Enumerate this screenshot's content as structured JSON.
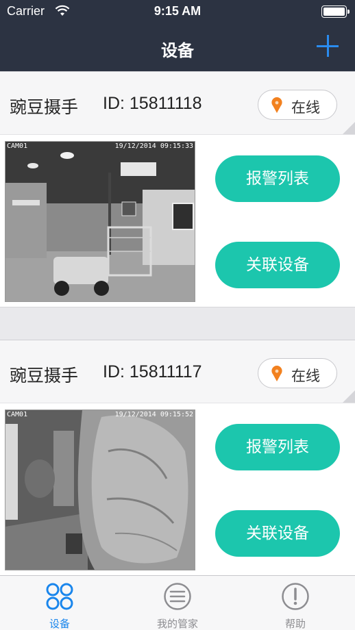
{
  "status_bar": {
    "carrier": "Carrier",
    "time": "9:15 AM"
  },
  "nav": {
    "title": "设备",
    "add_icon": "plus-icon"
  },
  "devices": [
    {
      "name": "豌豆摄手",
      "id_text": "ID: 15811118",
      "status": "在线",
      "cam_label": "CAM01",
      "cam_timestamp": "19/12/2014 09:15:33",
      "alarm_button": "报警列表",
      "link_button": "关联设备"
    },
    {
      "name": "豌豆摄手",
      "id_text": "ID: 15811117",
      "status": "在线",
      "cam_label": "CAM01",
      "cam_timestamp": "19/12/2014 09:15:52",
      "alarm_button": "报警列表",
      "link_button": "关联设备"
    }
  ],
  "tabs": [
    {
      "label": "设备",
      "icon": "devices-grid-icon",
      "active": true
    },
    {
      "label": "我的管家",
      "icon": "list-circle-icon",
      "active": false
    },
    {
      "label": "帮助",
      "icon": "exclamation-circle-icon",
      "active": false
    }
  ],
  "colors": {
    "nav_background": "#2c3342",
    "accent_blue": "#1a86ec",
    "button_teal": "#1cc6ad",
    "pin_orange": "#f2811f"
  }
}
